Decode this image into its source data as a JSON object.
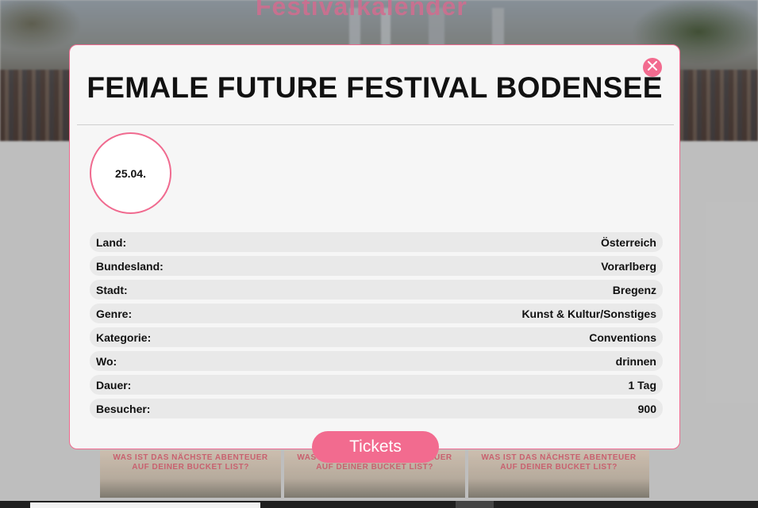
{
  "background": {
    "page_title": "Festivalkalender",
    "banners": [
      "WAS IST DAS NÄCHSTE ABENTEUER AUF DEINER BUCKET LIST?",
      "WAS IST DAS NÄCHSTE ABENTEUER AUF DEINER BUCKET LIST?",
      "WAS IST DAS NÄCHSTE ABENTEUER AUF DEINER BUCKET LIST?"
    ]
  },
  "modal": {
    "title": "FEMALE FUTURE FESTIVAL BODENSEE",
    "close_icon": "close-icon",
    "date": "25.04.",
    "details": [
      {
        "label": "Land:",
        "value": "Österreich"
      },
      {
        "label": "Bundesland:",
        "value": "Vorarlberg"
      },
      {
        "label": "Stadt:",
        "value": "Bregenz"
      },
      {
        "label": "Genre:",
        "value": "Kunst & Kultur/Sonstiges"
      },
      {
        "label": "Kategorie:",
        "value": "Conventions"
      },
      {
        "label": "Wo:",
        "value": "drinnen"
      },
      {
        "label": "Dauer:",
        "value": "1 Tag"
      },
      {
        "label": "Besucher:",
        "value": "900"
      }
    ],
    "tickets_label": "Tickets"
  },
  "colors": {
    "accent": "#f26b8f",
    "modal_background": "#f6f6f6",
    "row_background": "#e9e9e9"
  }
}
